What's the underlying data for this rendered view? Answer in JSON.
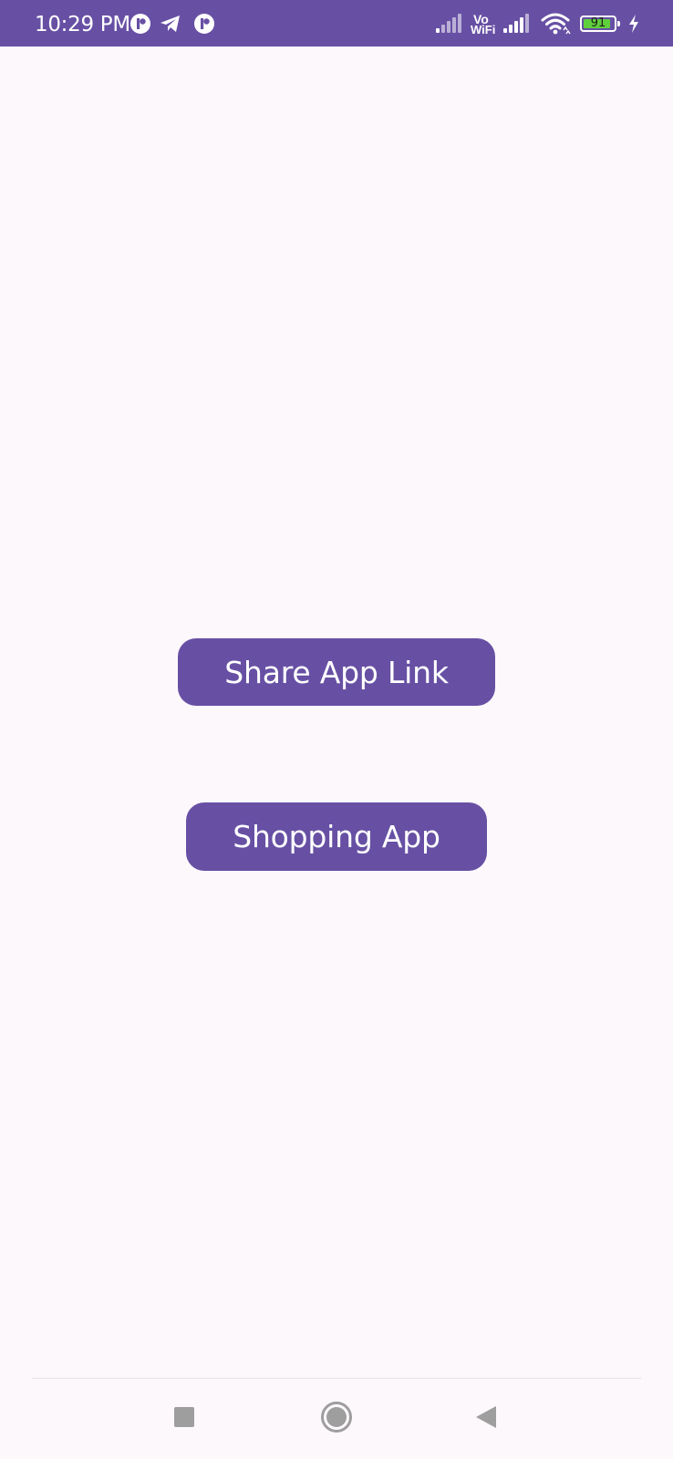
{
  "status_bar": {
    "time": "10:29 PM",
    "vowifi_top": "Vo",
    "vowifi_bottom": "WiFi",
    "battery_level": "91",
    "battery_fraction": 0.91,
    "icons": [
      "app-notification-icon",
      "telegram-icon",
      "app-notification-icon",
      "cellular-signal-icon",
      "vowifi-icon",
      "cellular-signal-icon",
      "wifi-icon",
      "battery-icon",
      "charging-icon"
    ]
  },
  "main": {
    "share_button_label": "Share App Link",
    "shopping_button_label": "Shopping App"
  },
  "nav_bar": {
    "icons": [
      "recent-apps-icon",
      "home-icon",
      "back-icon"
    ]
  },
  "colors": {
    "primary": "#6750a4",
    "background": "#fdf8fc",
    "battery_fill": "#5fcf3c",
    "nav_icon": "#9e9e9e"
  }
}
